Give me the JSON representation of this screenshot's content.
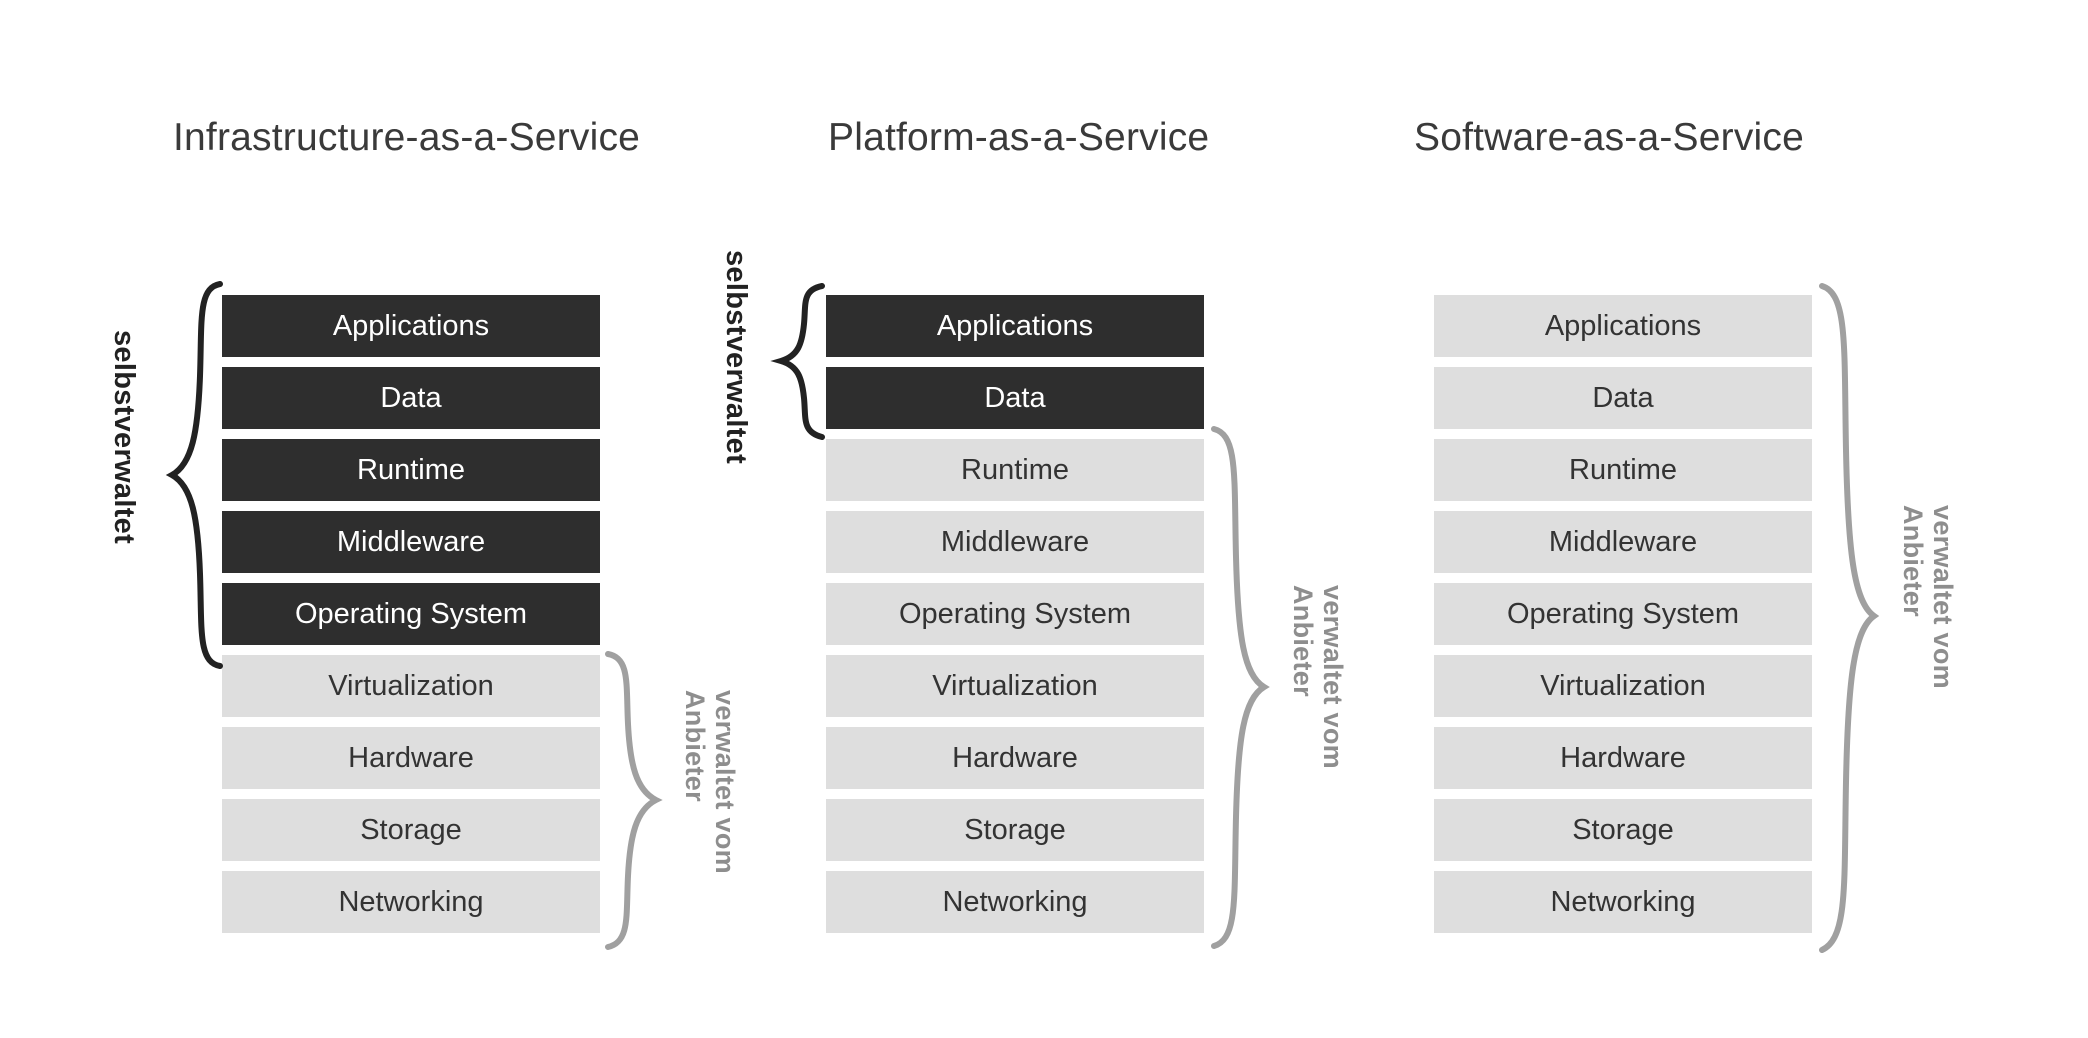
{
  "diagram": {
    "title_note": "Cloud service models responsibility diagram",
    "colors": {
      "managed_block": "#2e2e2e",
      "provider_block": "#dedede",
      "self_managed_brace": "#222222",
      "provider_brace": "#8e8e8e",
      "background": "#ffffff"
    },
    "labels": {
      "self_managed": "selbstverwaltet",
      "provider_managed_line1": "verwaltet vom",
      "provider_managed_line2": "Anbieter"
    },
    "columns": [
      {
        "id": "iaas",
        "title": "Infrastructure-as-a-Service",
        "layers": [
          {
            "label": "Applications",
            "ownership": "self"
          },
          {
            "label": "Data",
            "ownership": "self"
          },
          {
            "label": "Runtime",
            "ownership": "self"
          },
          {
            "label": "Middleware",
            "ownership": "self"
          },
          {
            "label": "Operating System",
            "ownership": "self"
          },
          {
            "label": "Virtualization",
            "ownership": "provider"
          },
          {
            "label": "Hardware",
            "ownership": "provider"
          },
          {
            "label": "Storage",
            "ownership": "provider"
          },
          {
            "label": "Networking",
            "ownership": "provider"
          }
        ],
        "self_managed_count": 5,
        "provider_managed_count": 4
      },
      {
        "id": "paas",
        "title": "Platform-as-a-Service",
        "layers": [
          {
            "label": "Applications",
            "ownership": "self"
          },
          {
            "label": "Data",
            "ownership": "self"
          },
          {
            "label": "Runtime",
            "ownership": "provider"
          },
          {
            "label": "Middleware",
            "ownership": "provider"
          },
          {
            "label": "Operating System",
            "ownership": "provider"
          },
          {
            "label": "Virtualization",
            "ownership": "provider"
          },
          {
            "label": "Hardware",
            "ownership": "provider"
          },
          {
            "label": "Storage",
            "ownership": "provider"
          },
          {
            "label": "Networking",
            "ownership": "provider"
          }
        ],
        "self_managed_count": 2,
        "provider_managed_count": 7
      },
      {
        "id": "saas",
        "title": "Software-as-a-Service",
        "layers": [
          {
            "label": "Applications",
            "ownership": "provider"
          },
          {
            "label": "Data",
            "ownership": "provider"
          },
          {
            "label": "Runtime",
            "ownership": "provider"
          },
          {
            "label": "Middleware",
            "ownership": "provider"
          },
          {
            "label": "Operating System",
            "ownership": "provider"
          },
          {
            "label": "Virtualization",
            "ownership": "provider"
          },
          {
            "label": "Hardware",
            "ownership": "provider"
          },
          {
            "label": "Storage",
            "ownership": "provider"
          },
          {
            "label": "Networking",
            "ownership": "provider"
          }
        ],
        "self_managed_count": 0,
        "provider_managed_count": 9
      }
    ]
  }
}
